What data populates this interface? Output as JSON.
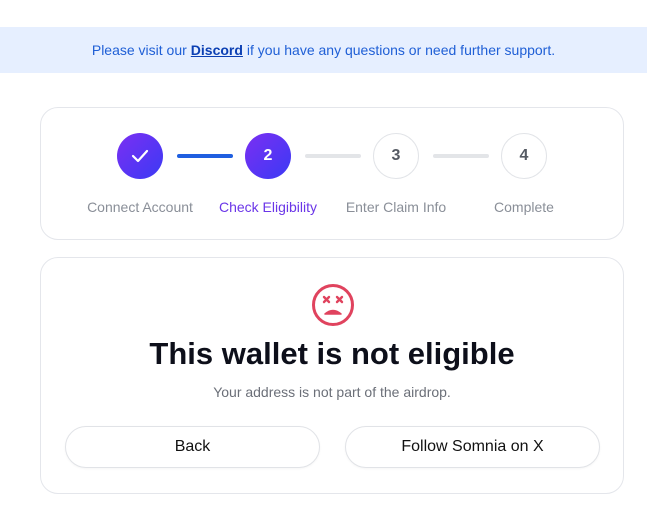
{
  "banner": {
    "prefix": "Please visit our",
    "link": "Discord",
    "suffix": "if you have any questions or need further support."
  },
  "stepper": {
    "steps": [
      {
        "number": "",
        "label": "Connect Account",
        "state": "done"
      },
      {
        "number": "2",
        "label": "Check Eligibility",
        "state": "active"
      },
      {
        "number": "3",
        "label": "Enter Claim Info",
        "state": "pending"
      },
      {
        "number": "4",
        "label": "Complete",
        "state": "pending"
      }
    ]
  },
  "result": {
    "icon": "sad-face-icon",
    "title": "This wallet is not eligible",
    "subtitle": "Your address is not part of the airdrop.",
    "back_label": "Back",
    "follow_label": "Follow Somnia on X"
  },
  "colors": {
    "accent_start": "#7b2ff2",
    "accent_end": "#3b3af5",
    "connector_on": "#1f5fe0",
    "error": "#e0435e",
    "banner_bg": "#e6efff"
  }
}
